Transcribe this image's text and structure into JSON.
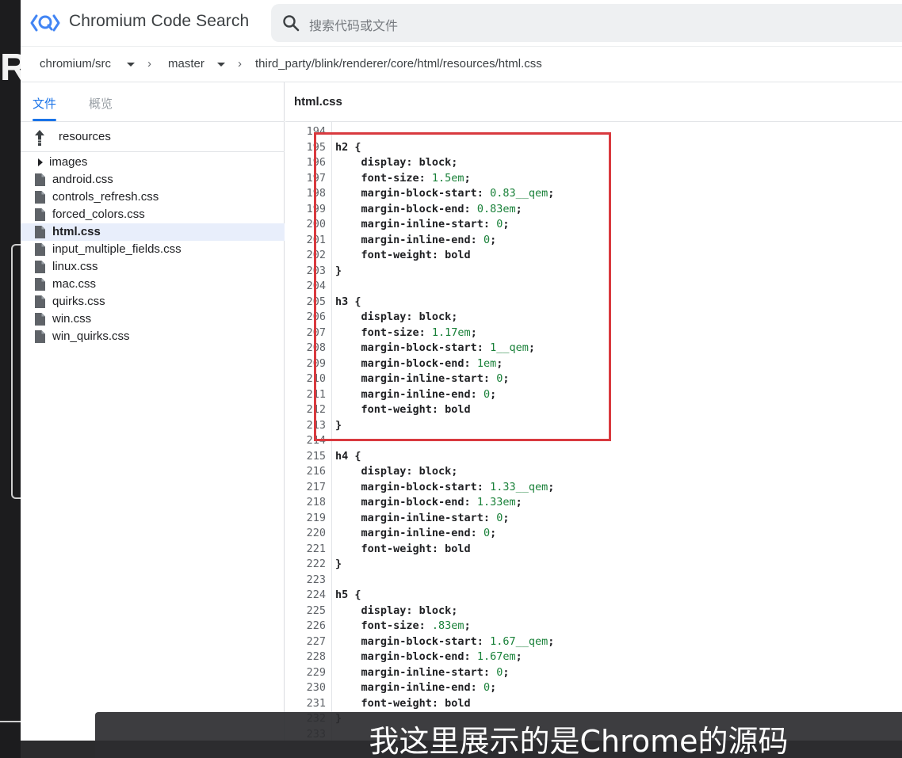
{
  "app": {
    "logo_text": "Chromium Code Search",
    "search_placeholder": "搜索代码或文件"
  },
  "breadcrumb": {
    "repo": "chromium/src",
    "branch": "master",
    "path": "third_party/blink/renderer/core/html/resources/html.css"
  },
  "sidebar": {
    "tabs": [
      {
        "label": "文件",
        "active": true
      },
      {
        "label": "概览",
        "active": false
      }
    ],
    "parent_folder": "resources",
    "items": [
      {
        "label": "images",
        "kind": "folder",
        "selected": false
      },
      {
        "label": "android.css",
        "kind": "file",
        "selected": false
      },
      {
        "label": "controls_refresh.css",
        "kind": "file",
        "selected": false
      },
      {
        "label": "forced_colors.css",
        "kind": "file",
        "selected": false
      },
      {
        "label": "html.css",
        "kind": "file",
        "selected": true
      },
      {
        "label": "input_multiple_fields.css",
        "kind": "file",
        "selected": false
      },
      {
        "label": "linux.css",
        "kind": "file",
        "selected": false
      },
      {
        "label": "mac.css",
        "kind": "file",
        "selected": false
      },
      {
        "label": "quirks.css",
        "kind": "file",
        "selected": false
      },
      {
        "label": "win.css",
        "kind": "file",
        "selected": false
      },
      {
        "label": "win_quirks.css",
        "kind": "file",
        "selected": false
      }
    ]
  },
  "editor": {
    "file_title": "html.css",
    "lines": [
      {
        "n": "194",
        "code": ""
      },
      {
        "n": "195",
        "code": "h2 {"
      },
      {
        "n": "196",
        "code": "    display: block;"
      },
      {
        "n": "197",
        "code": "    font-size: 1.5em;"
      },
      {
        "n": "198",
        "code": "    margin-block-start: 0.83__qem;"
      },
      {
        "n": "199",
        "code": "    margin-block-end: 0.83em;"
      },
      {
        "n": "200",
        "code": "    margin-inline-start: 0;"
      },
      {
        "n": "201",
        "code": "    margin-inline-end: 0;"
      },
      {
        "n": "202",
        "code": "    font-weight: bold"
      },
      {
        "n": "203",
        "code": "}"
      },
      {
        "n": "204",
        "code": ""
      },
      {
        "n": "205",
        "code": "h3 {"
      },
      {
        "n": "206",
        "code": "    display: block;"
      },
      {
        "n": "207",
        "code": "    font-size: 1.17em;"
      },
      {
        "n": "208",
        "code": "    margin-block-start: 1__qem;"
      },
      {
        "n": "209",
        "code": "    margin-block-end: 1em;"
      },
      {
        "n": "210",
        "code": "    margin-inline-start: 0;"
      },
      {
        "n": "211",
        "code": "    margin-inline-end: 0;"
      },
      {
        "n": "212",
        "code": "    font-weight: bold"
      },
      {
        "n": "213",
        "code": "}"
      },
      {
        "n": "214",
        "code": ""
      },
      {
        "n": "215",
        "code": "h4 {"
      },
      {
        "n": "216",
        "code": "    display: block;"
      },
      {
        "n": "217",
        "code": "    margin-block-start: 1.33__qem;"
      },
      {
        "n": "218",
        "code": "    margin-block-end: 1.33em;"
      },
      {
        "n": "219",
        "code": "    margin-inline-start: 0;"
      },
      {
        "n": "220",
        "code": "    margin-inline-end: 0;"
      },
      {
        "n": "221",
        "code": "    font-weight: bold"
      },
      {
        "n": "222",
        "code": "}"
      },
      {
        "n": "223",
        "code": ""
      },
      {
        "n": "224",
        "code": "h5 {"
      },
      {
        "n": "225",
        "code": "    display: block;"
      },
      {
        "n": "226",
        "code": "    font-size: .83em;"
      },
      {
        "n": "227",
        "code": "    margin-block-start: 1.67__qem;"
      },
      {
        "n": "228",
        "code": "    margin-block-end: 1.67em;"
      },
      {
        "n": "229",
        "code": "    margin-inline-start: 0;"
      },
      {
        "n": "230",
        "code": "    margin-inline-end: 0;"
      },
      {
        "n": "231",
        "code": "    font-weight: bold"
      },
      {
        "n": "232",
        "code": "}"
      },
      {
        "n": "233",
        "code": ""
      }
    ]
  },
  "highlight": {
    "color": "#d93a3f"
  },
  "subtitle": "我这里展示的是Chrome的源码",
  "colors": {
    "accent": "#1a73e8",
    "css_value": "#188038"
  }
}
